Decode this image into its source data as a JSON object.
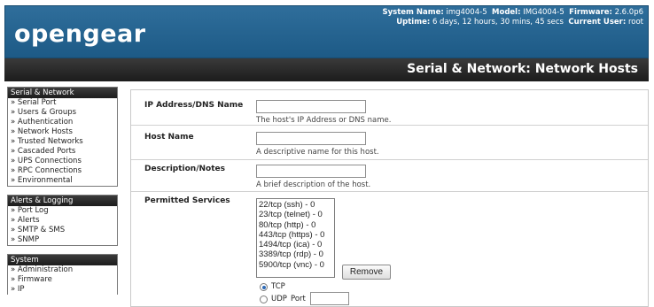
{
  "header": {
    "logo": "opengear",
    "system_name_label": "System Name:",
    "system_name": "img4004-5",
    "model_label": "Model:",
    "model": "IMG4004-5",
    "firmware_label": "Firmware:",
    "firmware": "2.6.0p6",
    "uptime_label": "Uptime:",
    "uptime": "6 days, 12 hours, 30 mins, 45 secs",
    "current_user_label": "Current User:",
    "current_user": "root"
  },
  "page_title": "Serial & Network: Network Hosts",
  "sidebar": {
    "sections": [
      {
        "title": "Serial & Network",
        "items": [
          "» Serial Port",
          "» Users & Groups",
          "» Authentication",
          "» Network Hosts",
          "» Trusted Networks",
          "» Cascaded Ports",
          "» UPS Connections",
          "» RPC Connections",
          "» Environmental"
        ]
      },
      {
        "title": "Alerts & Logging",
        "items": [
          "» Port Log",
          "» Alerts",
          "» SMTP & SMS",
          "» SNMP"
        ]
      },
      {
        "title": "System",
        "items": [
          "» Administration",
          "» Firmware",
          "» IP"
        ]
      }
    ]
  },
  "form": {
    "ip": {
      "label": "IP Address/DNS Name",
      "value": "",
      "help": "The host's IP Address or DNS name."
    },
    "hostname": {
      "label": "Host Name",
      "value": "",
      "help": "A descriptive name for this host."
    },
    "description": {
      "label": "Description/Notes",
      "value": "",
      "help": "A brief description of the host."
    },
    "services": {
      "label": "Permitted Services",
      "items": [
        "22/tcp (ssh) - 0",
        "23/tcp (telnet) - 0",
        "80/tcp (http) - 0",
        "443/tcp (https) - 0",
        "1494/tcp (ica) - 0",
        "3389/tcp (rdp) - 0",
        "5900/tcp (vnc) - 0"
      ],
      "remove_label": "Remove",
      "tcp_label": "TCP",
      "udp_label": "UDP",
      "port_label": "Port",
      "port_value": "",
      "selected_protocol": "TCP"
    }
  }
}
